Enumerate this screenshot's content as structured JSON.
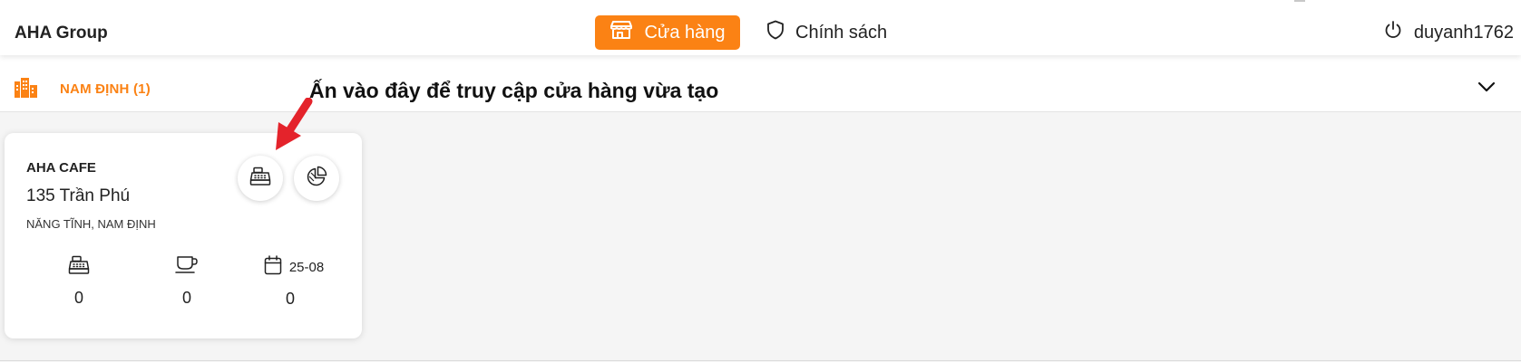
{
  "header": {
    "brand": "AHA Group",
    "nav": [
      {
        "label": "Cửa hàng",
        "icon": "store-icon",
        "active": true
      },
      {
        "label": "Chính sách",
        "icon": "shield-icon",
        "active": false
      }
    ],
    "user": {
      "name": "duyanh1762",
      "icon": "power-icon"
    }
  },
  "region": {
    "title": "NAM ĐỊNH (1)",
    "icon": "city-icon",
    "toggle_icon": "chevron-down-icon"
  },
  "annotation": {
    "text": "Ấn vào đây để truy cập cửa hàng vừa tạo"
  },
  "store_card": {
    "name": "AHA CAFE",
    "address": "135 Trần Phú",
    "area": "NĂNG TĨNH, NAM ĐỊNH",
    "actions": [
      {
        "icon": "cash-register-icon"
      },
      {
        "icon": "pie-chart-icon"
      }
    ],
    "stats": [
      {
        "icon": "cash-register-icon",
        "label": "",
        "value": "0"
      },
      {
        "icon": "coffee-cup-icon",
        "label": "",
        "value": "0"
      },
      {
        "icon": "calendar-icon",
        "label": "25-08",
        "value": "0"
      }
    ]
  },
  "colors": {
    "accent": "#fb8214",
    "arrow": "#e4232b",
    "background": "#f5f5f5"
  }
}
